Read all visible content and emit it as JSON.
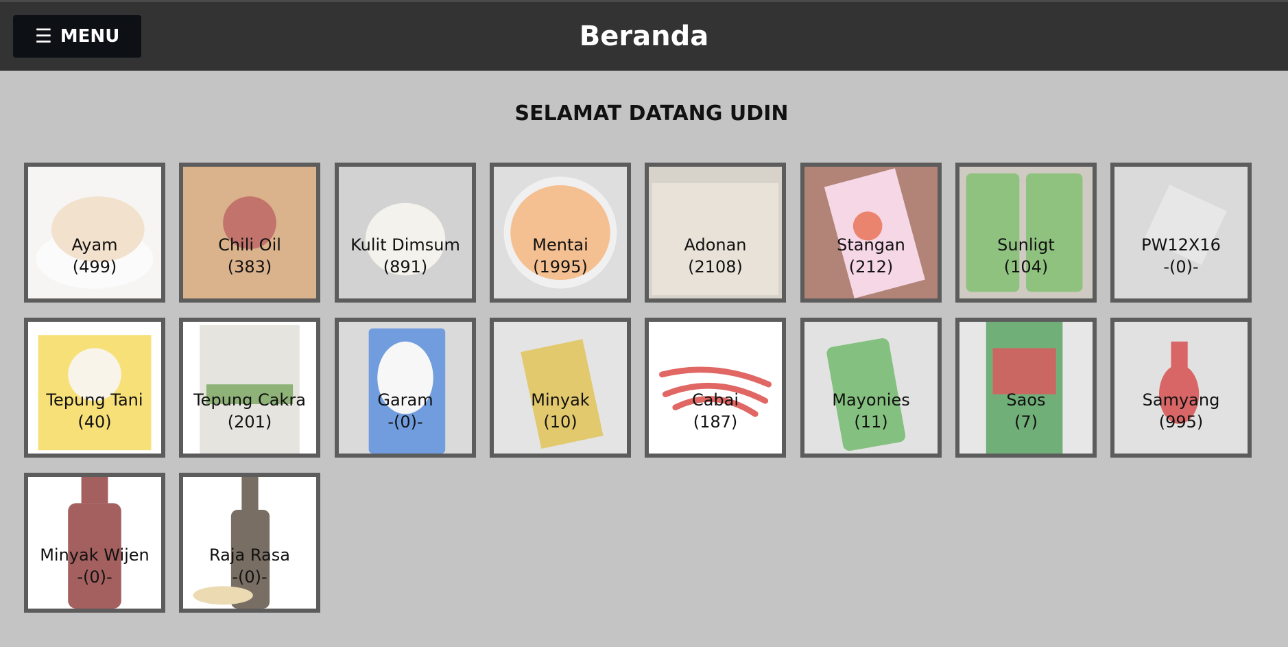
{
  "header": {
    "menu_label": "MENU",
    "menu_icon": "hamburger-icon",
    "title": "Beranda"
  },
  "welcome": "SELAMAT DATANG UDIN",
  "items": [
    {
      "name": "Ayam",
      "count": "(499)",
      "bg": "#f3f1ee",
      "accent": "#ecd3b6",
      "shape": "chicken"
    },
    {
      "name": "Chili Oil",
      "count": "(383)",
      "bg": "#c98e54",
      "accent": "#9b1b1b",
      "shape": "chili-oil"
    },
    {
      "name": "Kulit Dimsum",
      "count": "(891)",
      "bg": "#bdbdbd",
      "accent": "#efece4",
      "shape": "dimsum"
    },
    {
      "name": "Mentai",
      "count": "(1995)",
      "bg": "#cfcfcf",
      "accent": "#f1a35e",
      "shape": "bowl"
    },
    {
      "name": "Adonan",
      "count": "(2108)",
      "bg": "#c6beb2",
      "accent": "#ddd4c6",
      "shape": "dough"
    },
    {
      "name": "Stangan",
      "count": "(212)",
      "bg": "#8c4a37",
      "accent": "#f2c5d9",
      "shape": "glove"
    },
    {
      "name": "Sunligt",
      "count": "(104)",
      "bg": "#b8b2a6",
      "accent": "#5aa642",
      "shape": "sunlight"
    },
    {
      "name": "PW12X16",
      "count": "-(0)-",
      "bg": "#c9c9c9",
      "accent": "#dcdcdc",
      "shape": "plastic"
    },
    {
      "name": "Tepung Tani",
      "count": "(40)",
      "bg": "#ffffff",
      "accent": "#f5d23a",
      "shape": "flour-bag"
    },
    {
      "name": "Tepung Cakra",
      "count": "(201)",
      "bg": "#ffffff",
      "accent": "#d9d7cf",
      "shape": "sack"
    },
    {
      "name": "Garam",
      "count": "-(0)-",
      "bg": "#c9c9c9",
      "accent": "#2f6fd0",
      "shape": "salt"
    },
    {
      "name": "Minyak",
      "count": "(10)",
      "bg": "#d8d8d8",
      "accent": "#d4b02a",
      "shape": "oil-pouch"
    },
    {
      "name": "Cabai",
      "count": "(187)",
      "bg": "#ffffff",
      "accent": "#d2201a",
      "shape": "chilies"
    },
    {
      "name": "Mayonies",
      "count": "(11)",
      "bg": "#d4d4d4",
      "accent": "#4aa243",
      "shape": "mayo"
    },
    {
      "name": "Saos",
      "count": "(7)",
      "bg": "#dcdcdc",
      "accent": "#2f8a3a",
      "shape": "sauce"
    },
    {
      "name": "Samyang",
      "count": "(995)",
      "bg": "#d3d3d3",
      "accent": "#c81e1e",
      "shape": "bottle-small"
    },
    {
      "name": "Minyak Wijen",
      "count": "-(0)-",
      "bg": "#ffffff",
      "accent": "#7a1414",
      "shape": "bottle"
    },
    {
      "name": "Raja Rasa",
      "count": "-(0)-",
      "bg": "#ffffff",
      "accent": "#3a2a1a",
      "shape": "soy-bottle"
    }
  ]
}
